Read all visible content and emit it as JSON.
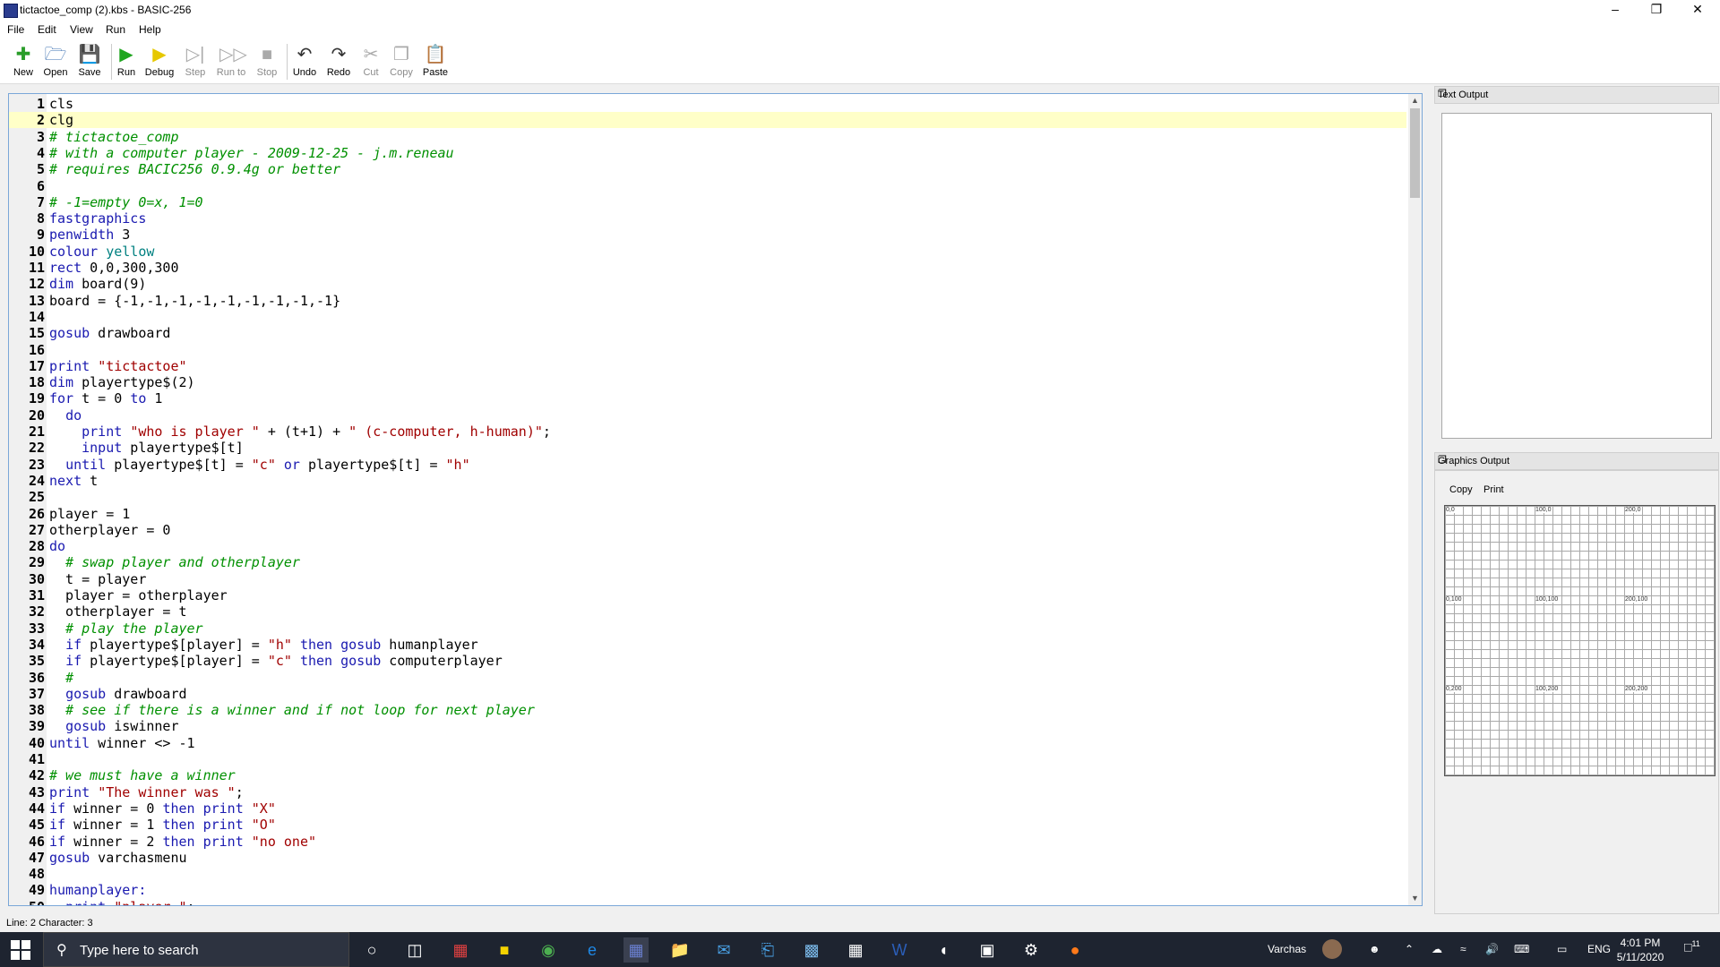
{
  "window": {
    "title": "tictactoe_comp (2).kbs - BASIC-256",
    "minimize": "–",
    "maximize": "❐",
    "close": "✕"
  },
  "menu": [
    "File",
    "Edit",
    "View",
    "Run",
    "Help"
  ],
  "toolbar": {
    "new": "New",
    "open": "Open",
    "save": "Save",
    "run": "Run",
    "debug": "Debug",
    "step": "Step",
    "run_to": "Run to",
    "stop": "Stop",
    "undo": "Undo",
    "redo": "Redo",
    "cut": "Cut",
    "copy": "Copy",
    "paste": "Paste"
  },
  "editor": {
    "current_line": 2,
    "lines": [
      {
        "n": "1",
        "t": [
          [
            "nm",
            "cls"
          ]
        ]
      },
      {
        "n": "2",
        "t": [
          [
            "nm",
            "clg"
          ]
        ]
      },
      {
        "n": "3",
        "t": [
          [
            "cm",
            "# tictactoe_comp"
          ]
        ]
      },
      {
        "n": "4",
        "t": [
          [
            "cm",
            "# with a computer player - 2009-12-25 - j.m.reneau"
          ]
        ]
      },
      {
        "n": "5",
        "t": [
          [
            "cm",
            "# requires BACIC256 0.9.4g or better"
          ]
        ]
      },
      {
        "n": "6",
        "t": []
      },
      {
        "n": "7",
        "t": [
          [
            "cm",
            "# -1=empty 0=x, 1=0"
          ]
        ]
      },
      {
        "n": "8",
        "t": [
          [
            "kw",
            "fastgraphics"
          ]
        ]
      },
      {
        "n": "9",
        "t": [
          [
            "kw",
            "penwidth"
          ],
          [
            "nm",
            " 3"
          ]
        ]
      },
      {
        "n": "10",
        "t": [
          [
            "kw",
            "colour"
          ],
          [
            "nm",
            " "
          ],
          [
            "cl",
            "yellow"
          ]
        ]
      },
      {
        "n": "11",
        "t": [
          [
            "kw",
            "rect"
          ],
          [
            "nm",
            " 0,0,300,300"
          ]
        ]
      },
      {
        "n": "12",
        "t": [
          [
            "kw",
            "dim"
          ],
          [
            "nm",
            " board(9)"
          ]
        ]
      },
      {
        "n": "13",
        "t": [
          [
            "nm",
            "board = {-1,-1,-1,-1,-1,-1,-1,-1,-1}"
          ]
        ]
      },
      {
        "n": "14",
        "t": []
      },
      {
        "n": "15",
        "t": [
          [
            "kw",
            "gosub"
          ],
          [
            "nm",
            " drawboard"
          ]
        ]
      },
      {
        "n": "16",
        "t": []
      },
      {
        "n": "17",
        "t": [
          [
            "kw",
            "print"
          ],
          [
            "nm",
            " "
          ],
          [
            "st",
            "\"tictactoe\""
          ]
        ]
      },
      {
        "n": "18",
        "t": [
          [
            "kw",
            "dim"
          ],
          [
            "nm",
            " playertype$(2)"
          ]
        ]
      },
      {
        "n": "19",
        "t": [
          [
            "kw",
            "for"
          ],
          [
            "nm",
            " t = 0 "
          ],
          [
            "kw",
            "to"
          ],
          [
            "nm",
            " 1"
          ]
        ]
      },
      {
        "n": "20",
        "t": [
          [
            "nm",
            "  "
          ],
          [
            "kw",
            "do"
          ]
        ]
      },
      {
        "n": "21",
        "t": [
          [
            "nm",
            "    "
          ],
          [
            "kw",
            "print"
          ],
          [
            "nm",
            " "
          ],
          [
            "st",
            "\"who is player \""
          ],
          [
            "nm",
            " + (t+1) + "
          ],
          [
            "st",
            "\" (c-computer, h-human)\""
          ],
          [
            "nm",
            ";"
          ]
        ]
      },
      {
        "n": "22",
        "t": [
          [
            "nm",
            "    "
          ],
          [
            "kw",
            "input"
          ],
          [
            "nm",
            " playertype$[t]"
          ]
        ]
      },
      {
        "n": "23",
        "t": [
          [
            "nm",
            "  "
          ],
          [
            "kw",
            "until"
          ],
          [
            "nm",
            " playertype$[t] = "
          ],
          [
            "st",
            "\"c\""
          ],
          [
            "nm",
            " "
          ],
          [
            "kw",
            "or"
          ],
          [
            "nm",
            " playertype$[t] = "
          ],
          [
            "st",
            "\"h\""
          ]
        ]
      },
      {
        "n": "24",
        "t": [
          [
            "kw",
            "next"
          ],
          [
            "nm",
            " t"
          ]
        ]
      },
      {
        "n": "25",
        "t": []
      },
      {
        "n": "26",
        "t": [
          [
            "nm",
            "player = 1"
          ]
        ]
      },
      {
        "n": "27",
        "t": [
          [
            "nm",
            "otherplayer = 0"
          ]
        ]
      },
      {
        "n": "28",
        "t": [
          [
            "kw",
            "do"
          ]
        ]
      },
      {
        "n": "29",
        "t": [
          [
            "nm",
            "  "
          ],
          [
            "cm",
            "# swap player and otherplayer"
          ]
        ]
      },
      {
        "n": "30",
        "t": [
          [
            "nm",
            "  t = player"
          ]
        ]
      },
      {
        "n": "31",
        "t": [
          [
            "nm",
            "  player = otherplayer"
          ]
        ]
      },
      {
        "n": "32",
        "t": [
          [
            "nm",
            "  otherplayer = t"
          ]
        ]
      },
      {
        "n": "33",
        "t": [
          [
            "nm",
            "  "
          ],
          [
            "cm",
            "# play the player"
          ]
        ]
      },
      {
        "n": "34",
        "t": [
          [
            "nm",
            "  "
          ],
          [
            "kw",
            "if"
          ],
          [
            "nm",
            " playertype$[player] = "
          ],
          [
            "st",
            "\"h\""
          ],
          [
            "nm",
            " "
          ],
          [
            "kw",
            "then"
          ],
          [
            "nm",
            " "
          ],
          [
            "kw",
            "gosub"
          ],
          [
            "nm",
            " humanplayer"
          ]
        ]
      },
      {
        "n": "35",
        "t": [
          [
            "nm",
            "  "
          ],
          [
            "kw",
            "if"
          ],
          [
            "nm",
            " playertype$[player] = "
          ],
          [
            "st",
            "\"c\""
          ],
          [
            "nm",
            " "
          ],
          [
            "kw",
            "then"
          ],
          [
            "nm",
            " "
          ],
          [
            "kw",
            "gosub"
          ],
          [
            "nm",
            " computerplayer"
          ]
        ]
      },
      {
        "n": "36",
        "t": [
          [
            "nm",
            "  "
          ],
          [
            "cm",
            "#"
          ]
        ]
      },
      {
        "n": "37",
        "t": [
          [
            "nm",
            "  "
          ],
          [
            "kw",
            "gosub"
          ],
          [
            "nm",
            " drawboard"
          ]
        ]
      },
      {
        "n": "38",
        "t": [
          [
            "nm",
            "  "
          ],
          [
            "cm",
            "# see if there is a winner and if not loop for next player"
          ]
        ]
      },
      {
        "n": "39",
        "t": [
          [
            "nm",
            "  "
          ],
          [
            "kw",
            "gosub"
          ],
          [
            "nm",
            " iswinner"
          ]
        ]
      },
      {
        "n": "40",
        "t": [
          [
            "kw",
            "until"
          ],
          [
            "nm",
            " winner <> -1"
          ]
        ]
      },
      {
        "n": "41",
        "t": []
      },
      {
        "n": "42",
        "t": [
          [
            "cm",
            "# we must have a winner"
          ]
        ]
      },
      {
        "n": "43",
        "t": [
          [
            "kw",
            "print"
          ],
          [
            "nm",
            " "
          ],
          [
            "st",
            "\"The winner was \""
          ],
          [
            "nm",
            ";"
          ]
        ]
      },
      {
        "n": "44",
        "t": [
          [
            "kw",
            "if"
          ],
          [
            "nm",
            " winner = 0 "
          ],
          [
            "kw",
            "then"
          ],
          [
            "nm",
            " "
          ],
          [
            "kw",
            "print"
          ],
          [
            "nm",
            " "
          ],
          [
            "st",
            "\"X\""
          ]
        ]
      },
      {
        "n": "45",
        "t": [
          [
            "kw",
            "if"
          ],
          [
            "nm",
            " winner = 1 "
          ],
          [
            "kw",
            "then"
          ],
          [
            "nm",
            " "
          ],
          [
            "kw",
            "print"
          ],
          [
            "nm",
            " "
          ],
          [
            "st",
            "\"O\""
          ]
        ]
      },
      {
        "n": "46",
        "t": [
          [
            "kw",
            "if"
          ],
          [
            "nm",
            " winner = 2 "
          ],
          [
            "kw",
            "then"
          ],
          [
            "nm",
            " "
          ],
          [
            "kw",
            "print"
          ],
          [
            "nm",
            " "
          ],
          [
            "st",
            "\"no one\""
          ]
        ]
      },
      {
        "n": "47",
        "t": [
          [
            "kw",
            "gosub"
          ],
          [
            "nm",
            " varchasmenu"
          ]
        ]
      },
      {
        "n": "48",
        "t": []
      },
      {
        "n": "49",
        "t": [
          [
            "kw",
            "humanplayer:"
          ]
        ]
      },
      {
        "n": "50",
        "t": [
          [
            "nm",
            "  "
          ],
          [
            "kw",
            "print"
          ],
          [
            "nm",
            " "
          ],
          [
            "st",
            "\"player \""
          ],
          [
            "nm",
            ";"
          ]
        ]
      }
    ]
  },
  "status": "Line: 2 Character: 3",
  "text_output": {
    "title": "Text Output"
  },
  "graphics_output": {
    "title": "Graphics Output",
    "copy": "Copy",
    "print": "Print",
    "labels": [
      "0,0",
      "100,0",
      "200,0",
      "0,100",
      "100,100",
      "200,100",
      "0,200",
      "100,200",
      "200,200"
    ]
  },
  "taskbar": {
    "search_placeholder": "Type here to search",
    "user": "Varchas",
    "lang": "ENG",
    "time": "4:01 PM",
    "date": "5/11/2020",
    "notifications": "11"
  },
  "colors": {
    "keyword": "#1a1ab0",
    "comment": "#009000",
    "string": "#a00000",
    "color_const": "#008080",
    "current_line": "#ffffc8"
  }
}
